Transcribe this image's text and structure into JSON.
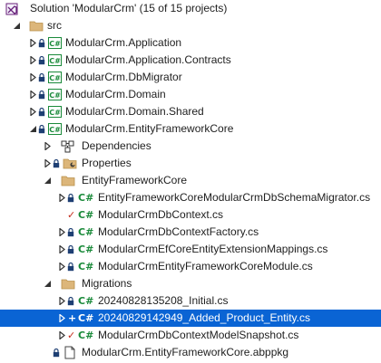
{
  "solution": {
    "label": "Solution 'ModularCrm' (15 of 15 projects)"
  },
  "src": {
    "label": "src"
  },
  "projects": [
    {
      "label": "ModularCrm.Application"
    },
    {
      "label": "ModularCrm.Application.Contracts"
    },
    {
      "label": "ModularCrm.DbMigrator"
    },
    {
      "label": "ModularCrm.Domain"
    },
    {
      "label": "ModularCrm.Domain.Shared"
    },
    {
      "label": "ModularCrm.EntityFrameworkCore"
    }
  ],
  "efcore": {
    "dependencies": "Dependencies",
    "properties": "Properties",
    "folder": "EntityFrameworkCore",
    "files": [
      "EntityFrameworkCoreModularCrmDbSchemaMigrator.cs",
      "ModularCrmDbContext.cs",
      "ModularCrmDbContextFactory.cs",
      "ModularCrmEfCoreEntityExtensionMappings.cs",
      "ModularCrmEntityFrameworkCoreModule.cs"
    ],
    "migrations_folder": "Migrations",
    "migrations": [
      "20240828135208_Initial.cs",
      "20240829142949_Added_Product_Entity.cs",
      "ModularCrmDbContextModelSnapshot.cs"
    ],
    "package_file": "ModularCrm.EntityFrameworkCore.abppkg"
  },
  "icons": {
    "csharp_glyph": "C#",
    "added_mark": "+",
    "modified_mark": "✓"
  },
  "colors": {
    "selection": "#0a64d4",
    "folder": "#dcb67a",
    "csharp": "#1a8a3a",
    "modified": "#c42b1c",
    "lock": "#1e3f73"
  }
}
